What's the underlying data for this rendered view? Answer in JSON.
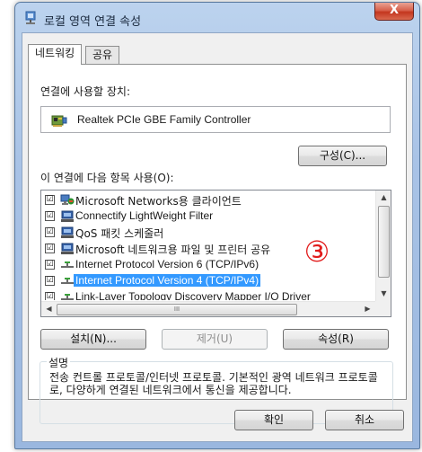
{
  "window": {
    "title": "로컬 영역 연결 속성",
    "close_label": "X"
  },
  "tabs": [
    {
      "label": "네트워킹"
    },
    {
      "label": "공유"
    }
  ],
  "connect_using": {
    "label": "연결에 사용할 장치:",
    "device": "Realtek PCIe GBE Family Controller",
    "configure_label": "구성(C)..."
  },
  "items_section": {
    "label": "이 연결에 다음 항목 사용(O):",
    "items": [
      {
        "label": "Microsoft Networks용 클라이언트",
        "checked": "☑",
        "icon": "network-client-icon"
      },
      {
        "label": "Connectify LightWeight Filter",
        "checked": "☑",
        "icon": "network-service-icon"
      },
      {
        "label": "QoS 패킷 스케줄러",
        "checked": "☑",
        "icon": "network-service-icon"
      },
      {
        "label": "Microsoft 네트워크용 파일 및 프린터 공유",
        "checked": "☑",
        "icon": "network-service-icon"
      },
      {
        "label": "Internet Protocol Version 6 (TCP/IPv6)",
        "checked": "☑",
        "icon": "protocol-icon"
      },
      {
        "label": "Internet Protocol Version 4 (TCP/IPv4)",
        "checked": "☑",
        "icon": "protocol-icon"
      },
      {
        "label": "Link-Layer Topology Discovery Mapper I/O Driver",
        "checked": "☑",
        "icon": "protocol-icon"
      }
    ],
    "selected_index": 5,
    "hscroll_grip": "III"
  },
  "item_buttons": {
    "install": "설치(N)...",
    "uninstall": "제거(U)",
    "properties": "속성(R)"
  },
  "description": {
    "title": "설명",
    "text": "전송 컨트롤 프로토콜/인터넷 프로토콜. 기본적인 광역 네트워크 프로토콜로, 다양하게 연결된 네트워크에서 통신을 제공합니다."
  },
  "annotation": "③",
  "footer": {
    "ok": "확인",
    "cancel": "취소"
  },
  "colors": {
    "selection": "#3399ff",
    "annotation": "#e11b1b",
    "titlebar": "#bcd3ee"
  }
}
